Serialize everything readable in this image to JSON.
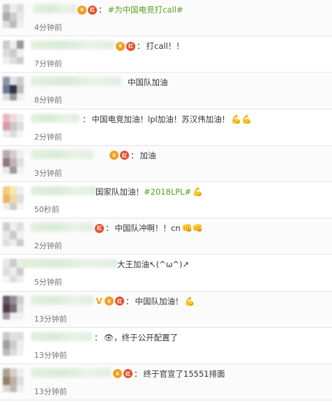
{
  "comments": [
    {
      "text_parts": [
        {
          "t": "#为中国电竞打call#",
          "cls": "tag"
        }
      ],
      "time": "4分钟前",
      "badges": [
        "crown",
        "red"
      ],
      "emoji": ""
    },
    {
      "text_parts": [
        {
          "t": "打call！！",
          "cls": ""
        }
      ],
      "time": "7分钟前",
      "badges": [
        "crown",
        "red"
      ],
      "emoji": ""
    },
    {
      "text_parts": [
        {
          "t": "中国队加油",
          "cls": ""
        }
      ],
      "time": "8分钟前",
      "badges": [],
      "emoji": ""
    },
    {
      "text_parts": [
        {
          "t": "中国电竞加油！lpl加油！苏汉伟加油！",
          "cls": ""
        }
      ],
      "time": "2分钟前",
      "badges": [],
      "emoji": "💪💪"
    },
    {
      "text_parts": [
        {
          "t": "加油",
          "cls": ""
        }
      ],
      "time": "3分钟前",
      "badges": [
        "crown",
        "red"
      ],
      "emoji": ""
    },
    {
      "text_parts": [
        {
          "t": "国家队加油！",
          "cls": ""
        },
        {
          "t": "#2018LPL#",
          "cls": "tag"
        }
      ],
      "time": "50秒前",
      "badges": [],
      "emoji": "💪"
    },
    {
      "text_parts": [
        {
          "t": "中国队冲啊！！cn",
          "cls": ""
        }
      ],
      "time": "2分钟前",
      "badges": [
        "red"
      ],
      "emoji": "👊👊"
    },
    {
      "text_parts": [
        {
          "t": "大王加油↖(^ω^)↗",
          "cls": ""
        }
      ],
      "time": "5分钟前",
      "badges": [],
      "emoji": ""
    },
    {
      "text_parts": [
        {
          "t": "中国队加油！",
          "cls": ""
        }
      ],
      "time": "13分钟前",
      "badges": [
        "v",
        "crown",
        "red"
      ],
      "emoji": "💪"
    },
    {
      "text_parts": [
        {
          "t": "👁，终于公开配置了",
          "cls": ""
        }
      ],
      "time": "13分钟前",
      "badges": [],
      "emoji": ""
    },
    {
      "text_parts": [
        {
          "t": "终于官宣了15551排面",
          "cls": ""
        }
      ],
      "time": "13分钟前",
      "badges": [
        "crown",
        "red"
      ],
      "emoji": ""
    }
  ],
  "colors": {
    "tag": "#5aa020",
    "time": "#777777",
    "badge_crown": "#f0a020",
    "badge_red": "#e2502c"
  }
}
